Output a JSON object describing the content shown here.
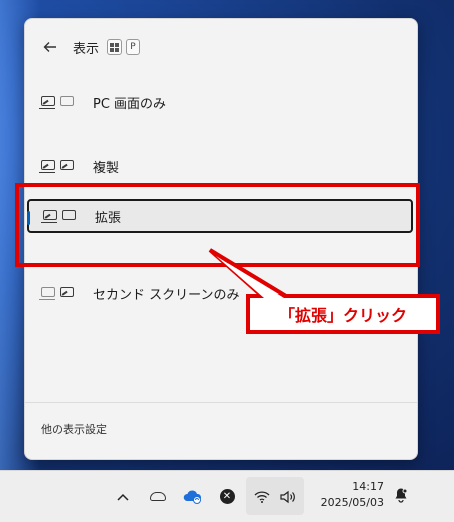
{
  "panel": {
    "title": "表示",
    "shortcut_keys": [
      "P"
    ],
    "options": [
      {
        "label": "PC 画面のみ",
        "icon": "pc-screen-only-icon",
        "selected": false
      },
      {
        "label": "複製",
        "icon": "duplicate-icon",
        "selected": false
      },
      {
        "label": "拡張",
        "icon": "extend-icon",
        "selected": true
      },
      {
        "label": "セカンド スクリーンのみ",
        "icon": "second-screen-only-icon",
        "selected": false
      }
    ],
    "footer_link": "他の表示設定"
  },
  "taskbar": {
    "time": "14:17",
    "date": "2025/05/03"
  },
  "annotation": {
    "callout_text": "「拡張」クリック",
    "color": "#e00000"
  }
}
